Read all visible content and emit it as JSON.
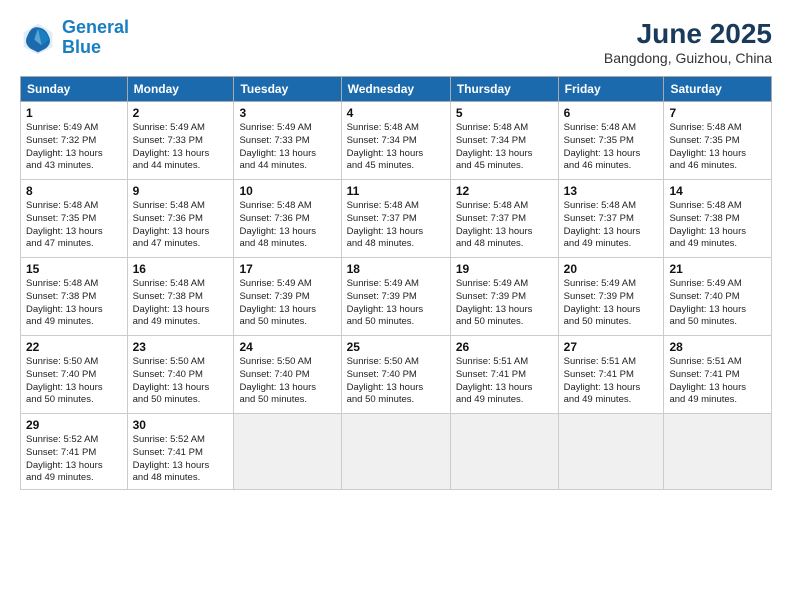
{
  "logo": {
    "line1": "General",
    "line2": "Blue"
  },
  "title": "June 2025",
  "subtitle": "Bangdong, Guizhou, China",
  "headers": [
    "Sunday",
    "Monday",
    "Tuesday",
    "Wednesday",
    "Thursday",
    "Friday",
    "Saturday"
  ],
  "weeks": [
    [
      {
        "day": "1",
        "info": "Sunrise: 5:49 AM\nSunset: 7:32 PM\nDaylight: 13 hours\nand 43 minutes."
      },
      {
        "day": "2",
        "info": "Sunrise: 5:49 AM\nSunset: 7:33 PM\nDaylight: 13 hours\nand 44 minutes."
      },
      {
        "day": "3",
        "info": "Sunrise: 5:49 AM\nSunset: 7:33 PM\nDaylight: 13 hours\nand 44 minutes."
      },
      {
        "day": "4",
        "info": "Sunrise: 5:48 AM\nSunset: 7:34 PM\nDaylight: 13 hours\nand 45 minutes."
      },
      {
        "day": "5",
        "info": "Sunrise: 5:48 AM\nSunset: 7:34 PM\nDaylight: 13 hours\nand 45 minutes."
      },
      {
        "day": "6",
        "info": "Sunrise: 5:48 AM\nSunset: 7:35 PM\nDaylight: 13 hours\nand 46 minutes."
      },
      {
        "day": "7",
        "info": "Sunrise: 5:48 AM\nSunset: 7:35 PM\nDaylight: 13 hours\nand 46 minutes."
      }
    ],
    [
      {
        "day": "8",
        "info": "Sunrise: 5:48 AM\nSunset: 7:35 PM\nDaylight: 13 hours\nand 47 minutes."
      },
      {
        "day": "9",
        "info": "Sunrise: 5:48 AM\nSunset: 7:36 PM\nDaylight: 13 hours\nand 47 minutes."
      },
      {
        "day": "10",
        "info": "Sunrise: 5:48 AM\nSunset: 7:36 PM\nDaylight: 13 hours\nand 48 minutes."
      },
      {
        "day": "11",
        "info": "Sunrise: 5:48 AM\nSunset: 7:37 PM\nDaylight: 13 hours\nand 48 minutes."
      },
      {
        "day": "12",
        "info": "Sunrise: 5:48 AM\nSunset: 7:37 PM\nDaylight: 13 hours\nand 48 minutes."
      },
      {
        "day": "13",
        "info": "Sunrise: 5:48 AM\nSunset: 7:37 PM\nDaylight: 13 hours\nand 49 minutes."
      },
      {
        "day": "14",
        "info": "Sunrise: 5:48 AM\nSunset: 7:38 PM\nDaylight: 13 hours\nand 49 minutes."
      }
    ],
    [
      {
        "day": "15",
        "info": "Sunrise: 5:48 AM\nSunset: 7:38 PM\nDaylight: 13 hours\nand 49 minutes."
      },
      {
        "day": "16",
        "info": "Sunrise: 5:48 AM\nSunset: 7:38 PM\nDaylight: 13 hours\nand 49 minutes."
      },
      {
        "day": "17",
        "info": "Sunrise: 5:49 AM\nSunset: 7:39 PM\nDaylight: 13 hours\nand 50 minutes."
      },
      {
        "day": "18",
        "info": "Sunrise: 5:49 AM\nSunset: 7:39 PM\nDaylight: 13 hours\nand 50 minutes."
      },
      {
        "day": "19",
        "info": "Sunrise: 5:49 AM\nSunset: 7:39 PM\nDaylight: 13 hours\nand 50 minutes."
      },
      {
        "day": "20",
        "info": "Sunrise: 5:49 AM\nSunset: 7:39 PM\nDaylight: 13 hours\nand 50 minutes."
      },
      {
        "day": "21",
        "info": "Sunrise: 5:49 AM\nSunset: 7:40 PM\nDaylight: 13 hours\nand 50 minutes."
      }
    ],
    [
      {
        "day": "22",
        "info": "Sunrise: 5:50 AM\nSunset: 7:40 PM\nDaylight: 13 hours\nand 50 minutes."
      },
      {
        "day": "23",
        "info": "Sunrise: 5:50 AM\nSunset: 7:40 PM\nDaylight: 13 hours\nand 50 minutes."
      },
      {
        "day": "24",
        "info": "Sunrise: 5:50 AM\nSunset: 7:40 PM\nDaylight: 13 hours\nand 50 minutes."
      },
      {
        "day": "25",
        "info": "Sunrise: 5:50 AM\nSunset: 7:40 PM\nDaylight: 13 hours\nand 50 minutes."
      },
      {
        "day": "26",
        "info": "Sunrise: 5:51 AM\nSunset: 7:41 PM\nDaylight: 13 hours\nand 49 minutes."
      },
      {
        "day": "27",
        "info": "Sunrise: 5:51 AM\nSunset: 7:41 PM\nDaylight: 13 hours\nand 49 minutes."
      },
      {
        "day": "28",
        "info": "Sunrise: 5:51 AM\nSunset: 7:41 PM\nDaylight: 13 hours\nand 49 minutes."
      }
    ],
    [
      {
        "day": "29",
        "info": "Sunrise: 5:52 AM\nSunset: 7:41 PM\nDaylight: 13 hours\nand 49 minutes."
      },
      {
        "day": "30",
        "info": "Sunrise: 5:52 AM\nSunset: 7:41 PM\nDaylight: 13 hours\nand 48 minutes."
      },
      {
        "day": "",
        "info": ""
      },
      {
        "day": "",
        "info": ""
      },
      {
        "day": "",
        "info": ""
      },
      {
        "day": "",
        "info": ""
      },
      {
        "day": "",
        "info": ""
      }
    ]
  ]
}
